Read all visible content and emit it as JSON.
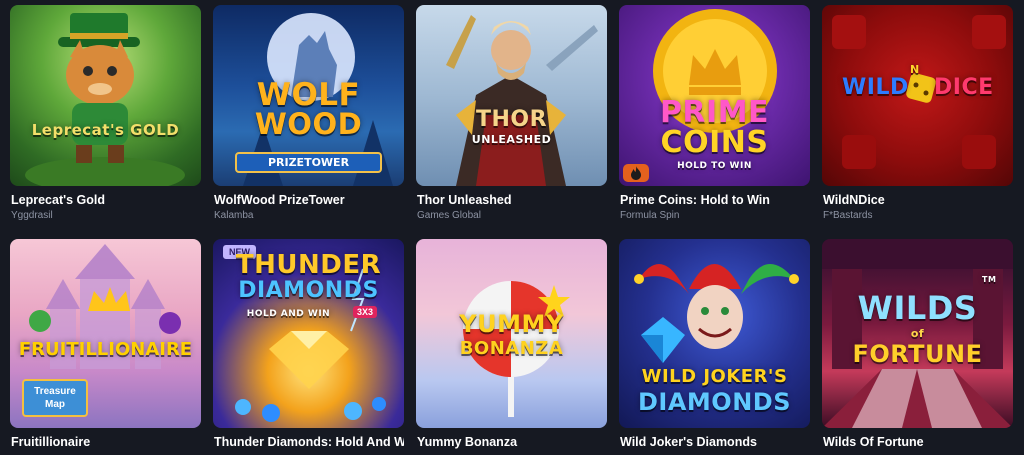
{
  "games": [
    {
      "title": "Leprecat's Gold",
      "provider": "Yggdrasil",
      "logo": "Leprecat's GOLD",
      "icon": "cat-leprechaun-art"
    },
    {
      "title": "WolfWood PrizeTower",
      "provider": "Kalamba",
      "logo_line1": "WOLF",
      "logo_line2": "WOOD",
      "logo_sub": "PRIZETOWER",
      "icon": "wolf-moon-art"
    },
    {
      "title": "Thor Unleashed",
      "provider": "Games Global",
      "logo_line1": "THOR",
      "logo_line2": "UNLEASHED",
      "icon": "thor-warrior-art"
    },
    {
      "title": "Prime Coins: Hold to Win",
      "provider": "Formula Spin",
      "logo_line1": "PRIME",
      "logo_line2": "COINS",
      "logo_sub": "HOLD TO WIN",
      "icon": "fire-icon"
    },
    {
      "title": "WildNDice",
      "provider": "F*Bastards",
      "logo_line1": "WILD",
      "logo_line2": "DICE",
      "logo_mid": "N",
      "icon": "dice-art"
    },
    {
      "title": "Fruitillionaire",
      "provider": "",
      "logo": "FRUITILLIONAIRE",
      "map_line1": "Treasure",
      "map_line2": "Map",
      "icon": "castle-art"
    },
    {
      "title": "Thunder Diamonds: Hold And Win",
      "provider": "",
      "badge": "NEW",
      "logo_line1": "THUNDER",
      "logo_line2": "DIAMONDS",
      "logo_sub": "HOLD AND WIN",
      "logo_tag": "3X3",
      "icon": "diamond-art"
    },
    {
      "title": "Yummy Bonanza",
      "provider": "",
      "logo_line1": "YUMMY",
      "logo_line2": "BONANZA",
      "icon": "candy-art"
    },
    {
      "title": "Wild Joker's Diamonds",
      "provider": "",
      "logo_line1": "WILD JOKER'S",
      "logo_line2": "DIAMONDS",
      "icon": "joker-art"
    },
    {
      "title": "Wilds Of Fortune",
      "provider": "",
      "logo_line1": "WILDS",
      "logo_mid": "of",
      "logo_line2": "FORTUNE",
      "logo_tm": "TM",
      "icon": "casino-art"
    }
  ],
  "colors": {
    "background": "#161922",
    "provider_text": "#8d93a3",
    "fire_badge": "#e4611d"
  }
}
